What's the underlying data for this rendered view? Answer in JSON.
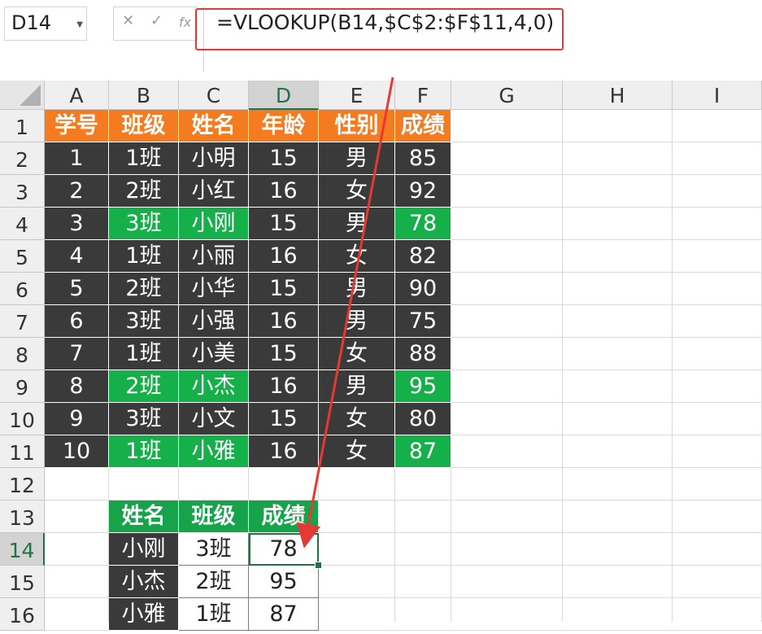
{
  "namebox": {
    "value": "D14"
  },
  "formula_bar": {
    "cancel": "✕",
    "enter": "✓",
    "fx": "fx",
    "formula": "=VLOOKUP(B14,$C$2:$F$11,4,0)"
  },
  "columns": [
    "A",
    "B",
    "C",
    "D",
    "E",
    "F",
    "G",
    "H",
    "I"
  ],
  "rows": [
    "1",
    "2",
    "3",
    "4",
    "5",
    "6",
    "7",
    "8",
    "9",
    "10",
    "11",
    "12",
    "13",
    "14",
    "15",
    "16"
  ],
  "table": {
    "headers": [
      "学号",
      "班级",
      "姓名",
      "年龄",
      "性别",
      "成绩"
    ],
    "rows": [
      [
        "1",
        "1班",
        "小明",
        "15",
        "男",
        "85"
      ],
      [
        "2",
        "2班",
        "小红",
        "16",
        "女",
        "92"
      ],
      [
        "3",
        "3班",
        "小刚",
        "15",
        "男",
        "78"
      ],
      [
        "4",
        "1班",
        "小丽",
        "16",
        "女",
        "82"
      ],
      [
        "5",
        "2班",
        "小华",
        "15",
        "男",
        "90"
      ],
      [
        "6",
        "3班",
        "小强",
        "16",
        "男",
        "75"
      ],
      [
        "7",
        "1班",
        "小美",
        "15",
        "女",
        "88"
      ],
      [
        "8",
        "2班",
        "小杰",
        "16",
        "男",
        "95"
      ],
      [
        "9",
        "3班",
        "小文",
        "15",
        "女",
        "80"
      ],
      [
        "10",
        "1班",
        "小雅",
        "16",
        "女",
        "87"
      ]
    ]
  },
  "lookup": {
    "headers": [
      "姓名",
      "班级",
      "成绩"
    ],
    "rows": [
      [
        "小刚",
        "3班",
        "78"
      ],
      [
        "小杰",
        "2班",
        "95"
      ],
      [
        "小雅",
        "1班",
        "87"
      ]
    ]
  },
  "colors": {
    "header_orange": "#f47b20",
    "dark_cell": "#3a3a3a",
    "highlight_green": "#16b04a",
    "excel_green": "#217346",
    "annotation_red": "#e53935"
  }
}
